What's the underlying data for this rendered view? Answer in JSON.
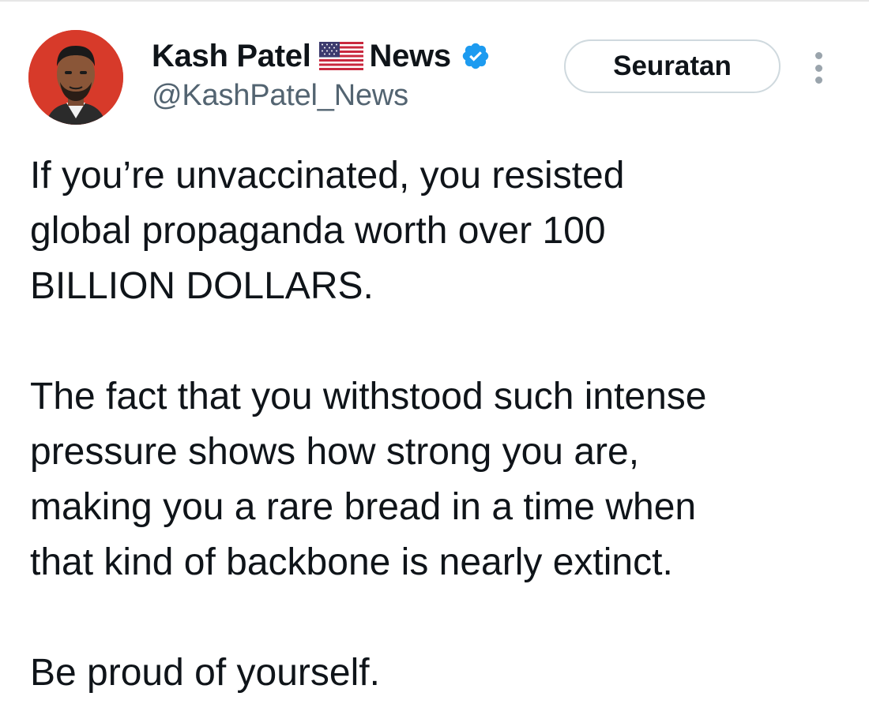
{
  "tweet": {
    "author": {
      "name_first": "Kash Patel",
      "name_second": "News",
      "handle": "@KashPatel_News",
      "avatar_icon": "avatar-portrait",
      "flag_icon": "us-flag-icon",
      "verified_icon": "verified-badge-icon",
      "verified_color": "#1d9bf0"
    },
    "follow_button_label": "Seuratan",
    "more_icon": "more-vertical-icon",
    "body": {
      "paragraph1": [
        "If you’re unvaccinated, you resisted",
        "global propaganda worth over 100",
        "BILLION DOLLARS."
      ],
      "paragraph2": [
        "The fact that you withstood such intense",
        "pressure shows how strong you are,",
        "making you a rare bread in a time when",
        "that kind of backbone is nearly extinct."
      ],
      "paragraph3": [
        "Be proud of yourself."
      ]
    }
  }
}
